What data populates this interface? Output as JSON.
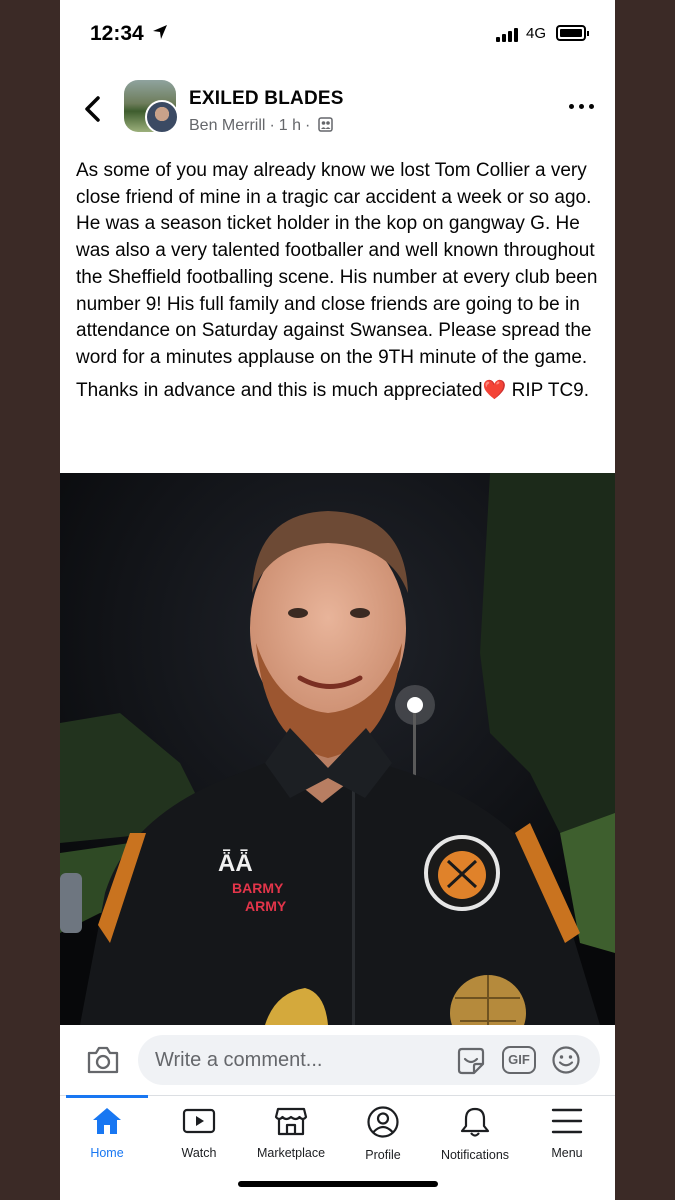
{
  "status_bar": {
    "time": "12:34",
    "network": "4G"
  },
  "post": {
    "group_name": "EXILED BLADES",
    "author": "Ben Merrill",
    "age": "1 h",
    "paragraph_1": "As some of you may already know we lost Tom Collier a very close friend of mine in a tragic car accident a week or so ago. He was a season ticket holder in the kop on gangway G. He was also a very talented footballer and well known throughout the Sheffield footballing scene. His number at every club been number 9! His full family and close friends are going to be in attendance on Saturday against Swansea. Please spread the word for a minutes applause on the 9TH minute of the game.",
    "paragraph_2_before": "Thanks in advance and this is much appreciated",
    "heart_emoji": "❤️",
    "paragraph_2_after": " RIP TC9."
  },
  "photo": {
    "jersey_text_1": "BARMY",
    "jersey_text_2": "ARMY"
  },
  "comment_bar": {
    "placeholder": "Write a comment...",
    "gif_label": "GIF"
  },
  "tabs": [
    {
      "label": "Home",
      "icon": "home-icon",
      "active": true
    },
    {
      "label": "Watch",
      "icon": "watch-icon",
      "active": false
    },
    {
      "label": "Marketplace",
      "icon": "marketplace-icon",
      "active": false
    },
    {
      "label": "Profile",
      "icon": "profile-icon",
      "active": false
    },
    {
      "label": "Notifications",
      "icon": "bell-icon",
      "active": false
    },
    {
      "label": "Menu",
      "icon": "menu-icon",
      "active": false
    }
  ],
  "colors": {
    "accent": "#1877f2",
    "text": "#050505",
    "secondary_text": "#65676b",
    "input_background": "#f0f2f5",
    "frame": "#3b2a26"
  }
}
